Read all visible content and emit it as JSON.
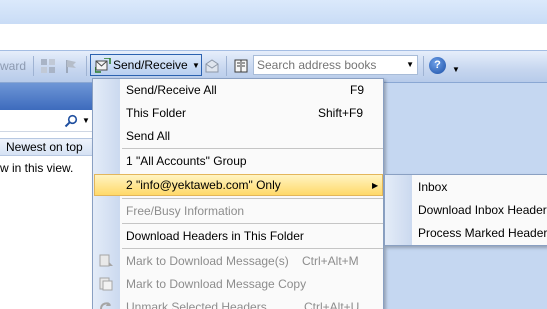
{
  "toolbar": {
    "forward_label": "ward",
    "send_receive_label": "Send/Receive",
    "search_placeholder": "Search address books",
    "help_label": "?"
  },
  "left_pane": {
    "arrange_label": "Newest on top",
    "empty_text": "w in this view."
  },
  "menu": {
    "items": [
      {
        "label": "Send/Receive All",
        "shortcut": "F9",
        "enabled": true
      },
      {
        "label": "This Folder",
        "shortcut": "Shift+F9",
        "enabled": true
      },
      {
        "label": "Send All",
        "shortcut": "",
        "enabled": true
      },
      {
        "label": "1 \"All Accounts\" Group",
        "shortcut": "",
        "enabled": true
      },
      {
        "label": "2 \"info@yektaweb.com\" Only",
        "shortcut": "",
        "enabled": true,
        "highlighted": true,
        "has_submenu": true
      },
      {
        "label": "Free/Busy Information",
        "shortcut": "",
        "enabled": false
      },
      {
        "label": "Download Headers in This Folder",
        "shortcut": "",
        "enabled": true
      },
      {
        "label": "Mark to Download Message(s)",
        "shortcut": "Ctrl+Alt+M",
        "enabled": false
      },
      {
        "label": "Mark to Download Message Copy",
        "shortcut": "",
        "enabled": false
      },
      {
        "label": "Unmark Selected Headers",
        "shortcut": "Ctrl+Alt+U",
        "enabled": false
      }
    ]
  },
  "submenu": {
    "items": [
      {
        "label": "Inbox"
      },
      {
        "label": "Download Inbox Headers"
      },
      {
        "label": "Process Marked Headers"
      }
    ]
  },
  "colors": {
    "highlight_top": "#fff4c2",
    "highlight_bottom": "#ffd96a",
    "gutter": "#cbd9ef",
    "toolbar": "#c6d6ef"
  }
}
